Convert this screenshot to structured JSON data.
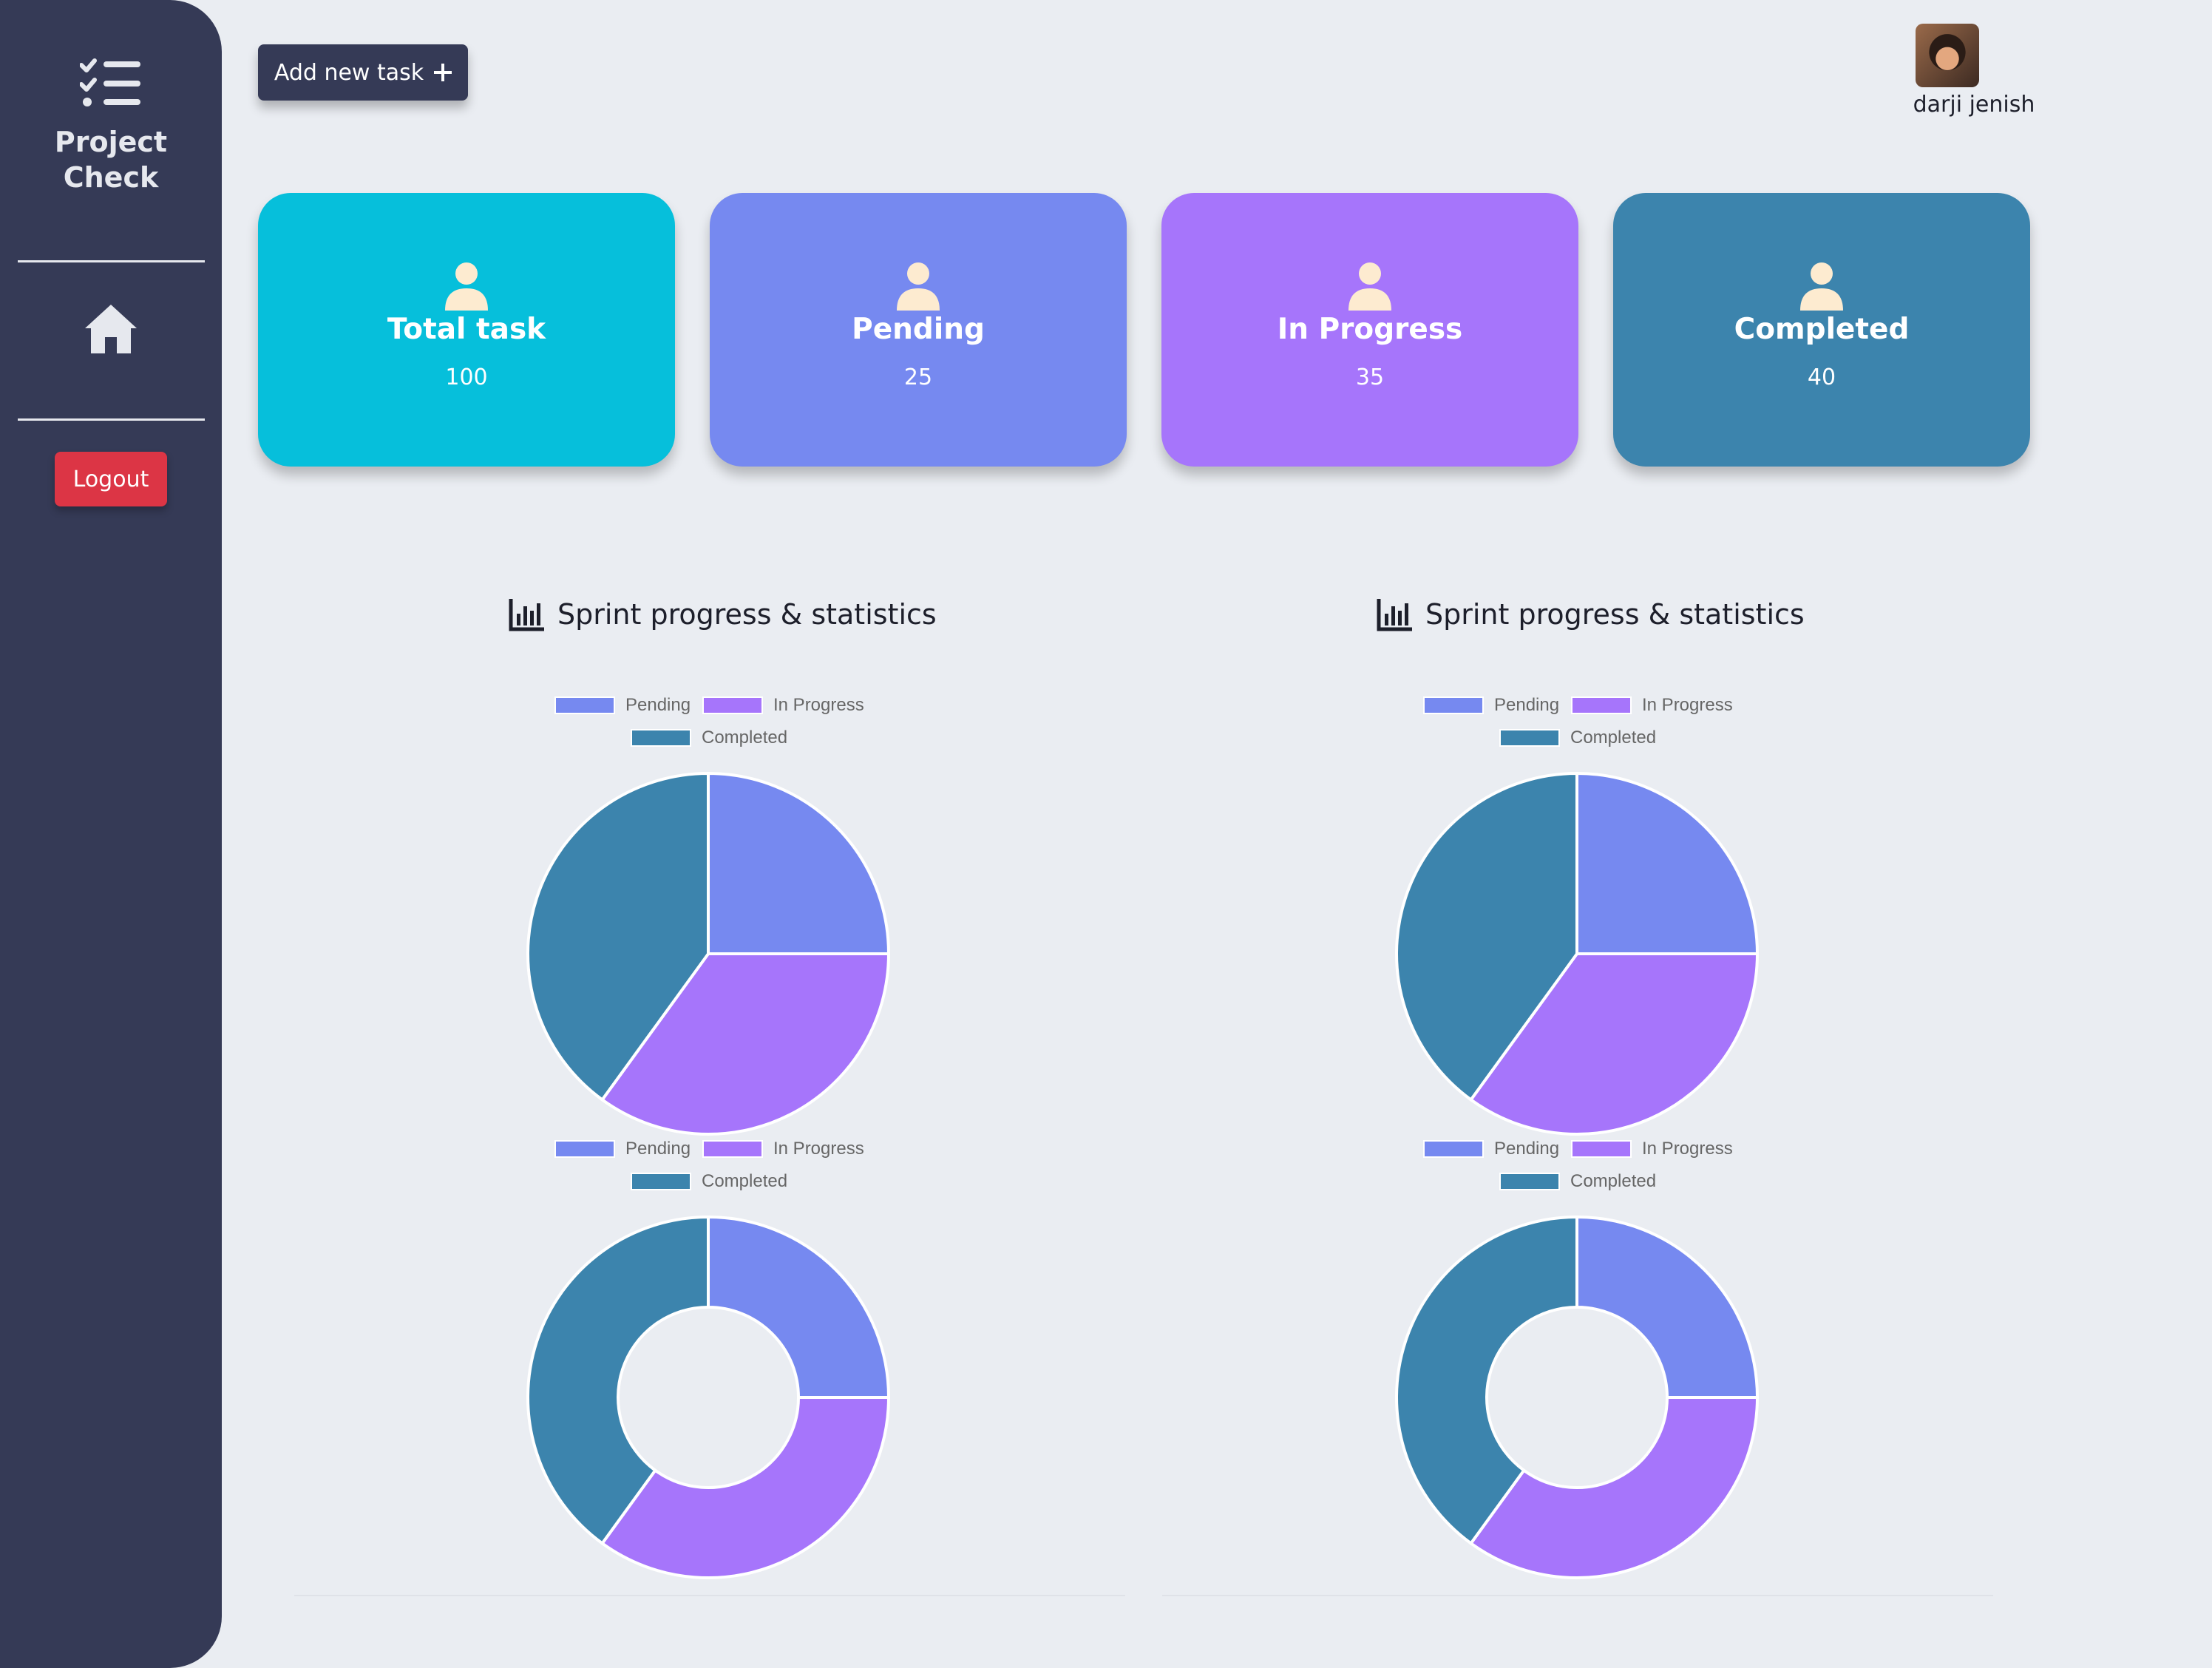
{
  "sidebar": {
    "brand_line1": "Project",
    "brand_line2": "Check",
    "logout_label": "Logout"
  },
  "header": {
    "add_task_label": "Add new task",
    "user_name": "darji jenish"
  },
  "cards": [
    {
      "label": "Total task",
      "value": "100",
      "color": "#06bfdb"
    },
    {
      "label": "Pending",
      "value": "25",
      "color": "#7689f0"
    },
    {
      "label": "In Progress",
      "value": "35",
      "color": "#a675fb"
    },
    {
      "label": "Completed",
      "value": "40",
      "color": "#3c84ad"
    }
  ],
  "charts_section": [
    {
      "title": "Sprint progress & statistics"
    },
    {
      "title": "Sprint progress & statistics"
    }
  ],
  "chart_data": [
    {
      "type": "pie",
      "categories": [
        "Pending",
        "In Progress",
        "Completed"
      ],
      "values": [
        25,
        35,
        40
      ],
      "colors": [
        "#7689f0",
        "#a675fb",
        "#3c84ad"
      ],
      "legend": "top"
    },
    {
      "type": "pie",
      "categories": [
        "Pending",
        "In Progress",
        "Completed"
      ],
      "values": [
        25,
        35,
        40
      ],
      "colors": [
        "#7689f0",
        "#a675fb",
        "#3c84ad"
      ],
      "legend": "top"
    },
    {
      "type": "pie",
      "variant": "doughnut",
      "categories": [
        "Pending",
        "In Progress",
        "Completed"
      ],
      "values": [
        25,
        35,
        40
      ],
      "colors": [
        "#7689f0",
        "#a675fb",
        "#3c84ad"
      ],
      "legend": "top"
    },
    {
      "type": "pie",
      "variant": "doughnut",
      "categories": [
        "Pending",
        "In Progress",
        "Completed"
      ],
      "values": [
        25,
        35,
        40
      ],
      "colors": [
        "#7689f0",
        "#a675fb",
        "#3c84ad"
      ],
      "legend": "top"
    }
  ]
}
